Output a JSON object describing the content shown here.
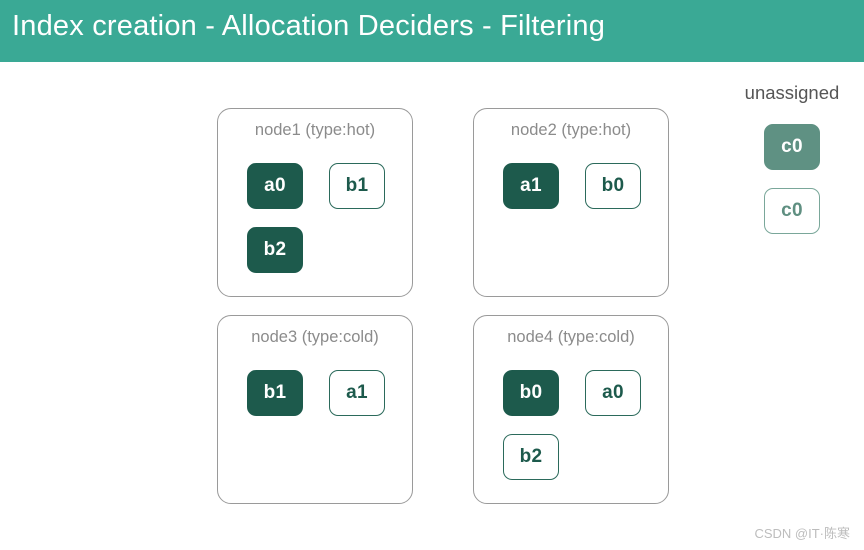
{
  "header": {
    "title": "Index creation - Allocation Deciders - Filtering",
    "background_color": "#3aa995",
    "text_color": "#ffffff"
  },
  "colors": {
    "header_teal": "#3aa995",
    "primary_shard_fill": "#1d5a4c",
    "replica_shard_border": "#2b6a5b",
    "unassigned_primary_fill": "#5f9183",
    "unassigned_replica_border": "#7aa79a",
    "node_box_border": "#9a9a9a",
    "node_title_text": "#8b8b8b",
    "page_background": "#ffffff"
  },
  "nodes": [
    {
      "id": "node1",
      "title": "node1 (type:hot)",
      "rows": [
        [
          {
            "label": "a0",
            "kind": "primary"
          },
          {
            "label": "b1",
            "kind": "replica"
          }
        ],
        [
          {
            "label": "b2",
            "kind": "primary"
          }
        ]
      ]
    },
    {
      "id": "node2",
      "title": "node2 (type:hot)",
      "rows": [
        [
          {
            "label": "a1",
            "kind": "primary"
          },
          {
            "label": "b0",
            "kind": "replica"
          }
        ]
      ]
    },
    {
      "id": "node3",
      "title": "node3 (type:cold)",
      "rows": [
        [
          {
            "label": "b1",
            "kind": "primary"
          },
          {
            "label": "a1",
            "kind": "replica"
          }
        ]
      ]
    },
    {
      "id": "node4",
      "title": "node4 (type:cold)",
      "rows": [
        [
          {
            "label": "b0",
            "kind": "primary"
          },
          {
            "label": "a0",
            "kind": "replica"
          }
        ],
        [
          {
            "label": "b2",
            "kind": "replica"
          }
        ]
      ]
    }
  ],
  "unassigned": {
    "label": "unassigned",
    "chips": [
      {
        "label": "c0",
        "kind": "unassigned-primary"
      },
      {
        "label": "c0",
        "kind": "unassigned-replica"
      }
    ]
  },
  "watermark": {
    "text": "CSDN @IT·陈寒"
  }
}
